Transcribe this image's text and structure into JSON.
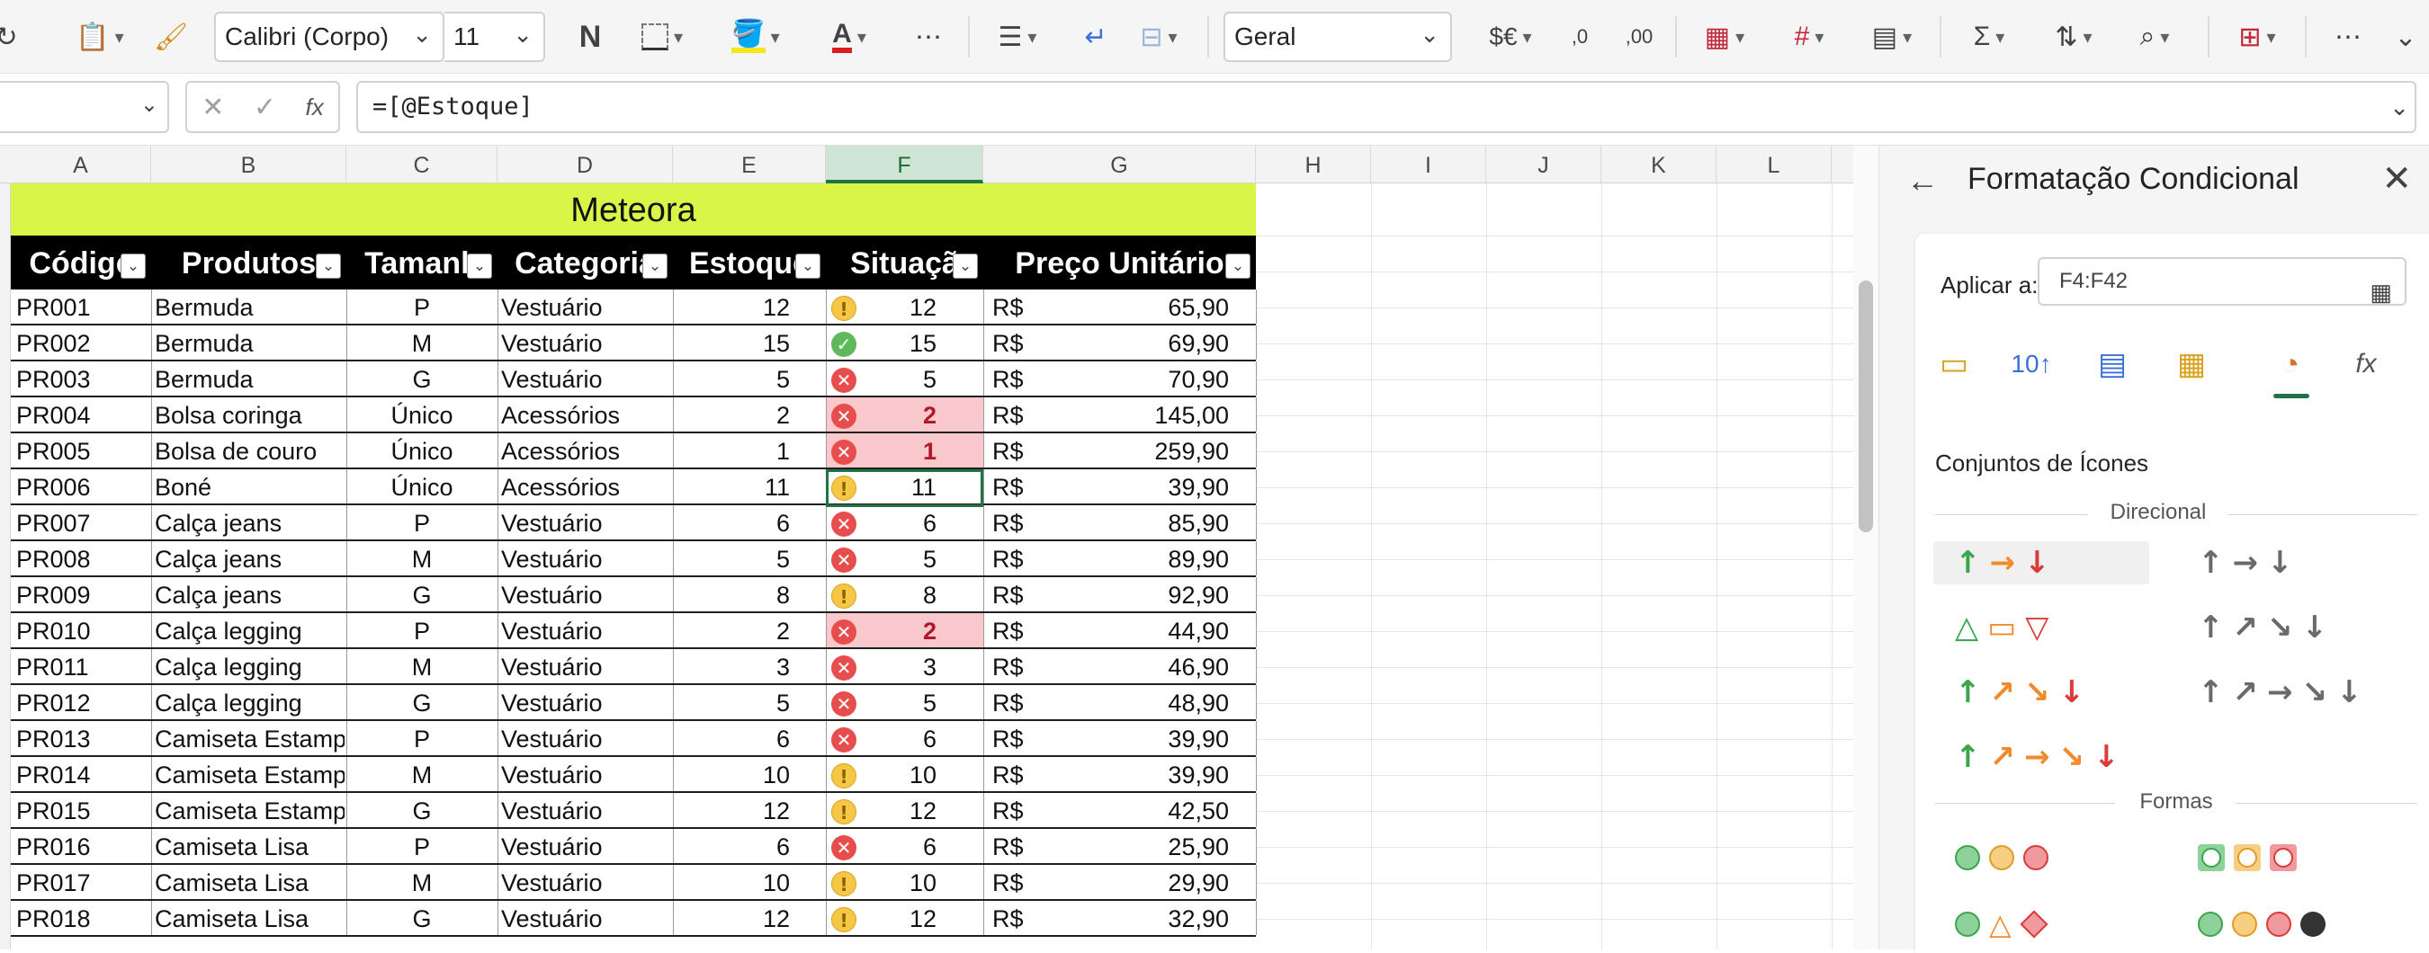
{
  "toolbar": {
    "font_name": "Calibri (Corpo)",
    "font_size": "11",
    "bold_label": "N",
    "number_format": "Geral",
    "currency_label": "$€",
    "dec_inc_label": ",0",
    "dec_dec_label": ",00"
  },
  "formula_bar": {
    "name_box": "",
    "fx_label": "fx",
    "formula": "=[@Estoque]"
  },
  "columns": [
    "A",
    "B",
    "C",
    "D",
    "E",
    "F",
    "G",
    "H",
    "I",
    "J",
    "K",
    "L"
  ],
  "selected_column": "F",
  "table": {
    "title": "Meteora",
    "headers": [
      "Códigc",
      "Produtos",
      "Tamanh",
      "Categoria",
      "Estoque",
      "Situaçã",
      "Preço Unitário"
    ],
    "currency_symbol": "R$",
    "rows": [
      {
        "codigo": "PR001",
        "produto": "Bermuda",
        "tamanho": "P",
        "categoria": "Vestuário",
        "estoque": "12",
        "icon": "warn",
        "situacao": "12",
        "highlight": false,
        "preco": "65,90"
      },
      {
        "codigo": "PR002",
        "produto": "Bermuda",
        "tamanho": "M",
        "categoria": "Vestuário",
        "estoque": "15",
        "icon": "ok",
        "situacao": "15",
        "highlight": false,
        "preco": "69,90"
      },
      {
        "codigo": "PR003",
        "produto": "Bermuda",
        "tamanho": "G",
        "categoria": "Vestuário",
        "estoque": "5",
        "icon": "bad",
        "situacao": "5",
        "highlight": false,
        "preco": "70,90"
      },
      {
        "codigo": "PR004",
        "produto": "Bolsa coringa",
        "tamanho": "Único",
        "categoria": "Acessórios",
        "estoque": "2",
        "icon": "bad",
        "situacao": "2",
        "highlight": true,
        "preco": "145,00"
      },
      {
        "codigo": "PR005",
        "produto": "Bolsa de couro",
        "tamanho": "Único",
        "categoria": "Acessórios",
        "estoque": "1",
        "icon": "bad",
        "situacao": "1",
        "highlight": true,
        "preco": "259,90"
      },
      {
        "codigo": "PR006",
        "produto": "Boné",
        "tamanho": "Único",
        "categoria": "Acessórios",
        "estoque": "11",
        "icon": "warn",
        "situacao": "11",
        "highlight": false,
        "preco": "39,90"
      },
      {
        "codigo": "PR007",
        "produto": "Calça jeans",
        "tamanho": "P",
        "categoria": "Vestuário",
        "estoque": "6",
        "icon": "bad",
        "situacao": "6",
        "highlight": false,
        "preco": "85,90"
      },
      {
        "codigo": "PR008",
        "produto": "Calça jeans",
        "tamanho": "M",
        "categoria": "Vestuário",
        "estoque": "5",
        "icon": "bad",
        "situacao": "5",
        "highlight": false,
        "preco": "89,90"
      },
      {
        "codigo": "PR009",
        "produto": "Calça jeans",
        "tamanho": "G",
        "categoria": "Vestuário",
        "estoque": "8",
        "icon": "warn",
        "situacao": "8",
        "highlight": false,
        "preco": "92,90"
      },
      {
        "codigo": "PR010",
        "produto": "Calça legging",
        "tamanho": "P",
        "categoria": "Vestuário",
        "estoque": "2",
        "icon": "bad",
        "situacao": "2",
        "highlight": true,
        "preco": "44,90"
      },
      {
        "codigo": "PR011",
        "produto": "Calça legging",
        "tamanho": "M",
        "categoria": "Vestuário",
        "estoque": "3",
        "icon": "bad",
        "situacao": "3",
        "highlight": false,
        "preco": "46,90"
      },
      {
        "codigo": "PR012",
        "produto": "Calça legging",
        "tamanho": "G",
        "categoria": "Vestuário",
        "estoque": "5",
        "icon": "bad",
        "situacao": "5",
        "highlight": false,
        "preco": "48,90"
      },
      {
        "codigo": "PR013",
        "produto": "Camiseta Estampa",
        "tamanho": "P",
        "categoria": "Vestuário",
        "estoque": "6",
        "icon": "bad",
        "situacao": "6",
        "highlight": false,
        "preco": "39,90"
      },
      {
        "codigo": "PR014",
        "produto": "Camiseta Estampa",
        "tamanho": "M",
        "categoria": "Vestuário",
        "estoque": "10",
        "icon": "warn",
        "situacao": "10",
        "highlight": false,
        "preco": "39,90"
      },
      {
        "codigo": "PR015",
        "produto": "Camiseta Estampa",
        "tamanho": "G",
        "categoria": "Vestuário",
        "estoque": "12",
        "icon": "warn",
        "situacao": "12",
        "highlight": false,
        "preco": "42,50"
      },
      {
        "codigo": "PR016",
        "produto": "Camiseta Lisa",
        "tamanho": "P",
        "categoria": "Vestuário",
        "estoque": "6",
        "icon": "bad",
        "situacao": "6",
        "highlight": false,
        "preco": "25,90"
      },
      {
        "codigo": "PR017",
        "produto": "Camiseta Lisa",
        "tamanho": "M",
        "categoria": "Vestuário",
        "estoque": "10",
        "icon": "warn",
        "situacao": "10",
        "highlight": false,
        "preco": "29,90"
      },
      {
        "codigo": "PR018",
        "produto": "Camiseta Lisa",
        "tamanho": "G",
        "categoria": "Vestuário",
        "estoque": "12",
        "icon": "warn",
        "situacao": "12",
        "highlight": false,
        "preco": "32,90"
      }
    ]
  },
  "pane": {
    "title": "Formatação Condicional",
    "apply_label": "Aplicar a:",
    "apply_range": "F4:F42",
    "section_label": "Conjuntos de Ícones",
    "group_directional": "Direcional",
    "group_shapes": "Formas"
  },
  "colors": {
    "title_fill": "#d9f548",
    "header_fill": "#000000",
    "highlight_fill": "#f8c8cd",
    "selection": "#217346"
  }
}
